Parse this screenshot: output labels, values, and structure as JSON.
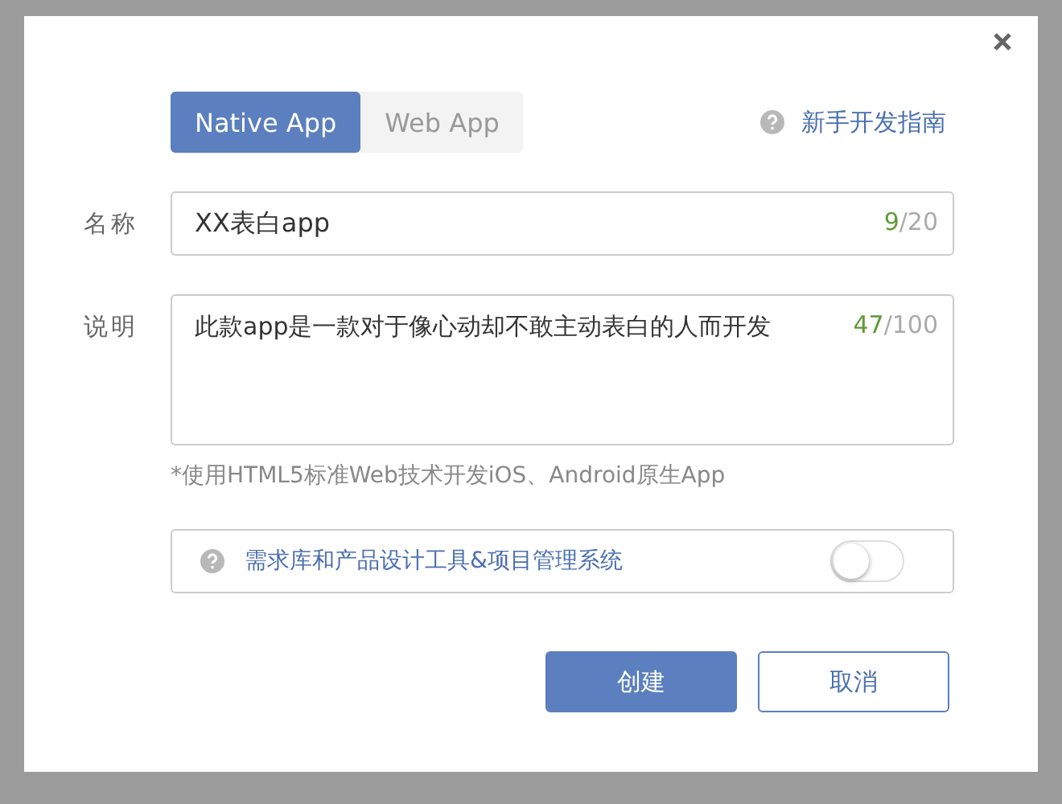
{
  "tabs": [
    {
      "label": "Native App",
      "selected": true
    },
    {
      "label": "Web App",
      "selected": false
    }
  ],
  "guide_link": {
    "label": "新手开发指南"
  },
  "fields": [
    {
      "label": "名称",
      "kind": "input",
      "value": "XX表白app",
      "count": "9",
      "max": "/20"
    },
    {
      "label": "说明",
      "kind": "textarea",
      "value": "此款app是一款对于像心动却不敢主动表白的人而开发",
      "count": "47",
      "max": "/100"
    }
  ],
  "hint": "*使用HTML5标准Web技术开发iOS、Android原生App",
  "option": {
    "label": "需求库和产品设计工具&项目管理系统",
    "on": false
  },
  "buttons": [
    {
      "label": "创建",
      "kind": "primary"
    },
    {
      "label": "取消",
      "kind": "secondary"
    }
  ]
}
